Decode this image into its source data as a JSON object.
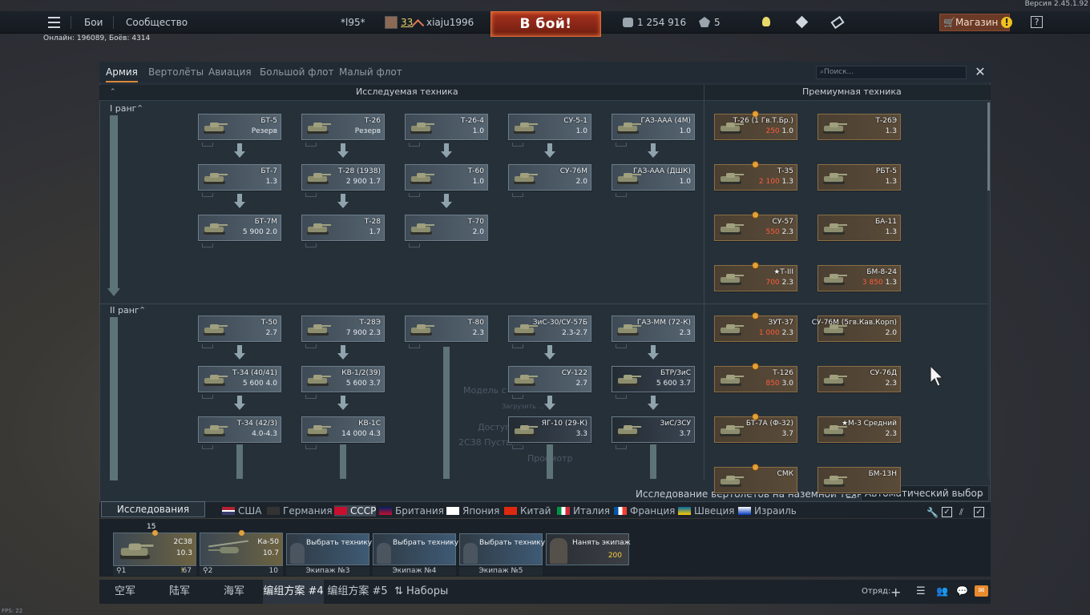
{
  "version": "Версия 2.45.1.92",
  "topbar": {
    "menu_icon": "hamburger-icon",
    "battles": "Бои",
    "community": "Сообщество",
    "squad_tag": "*l95*",
    "level": "33",
    "username": "xiaju1996",
    "battle_button": "В бой!",
    "silver": "1 254 916",
    "gold": "5",
    "shop": "Магазин",
    "shop_alert": "!",
    "help": "?"
  },
  "online": "Онлайн: 196089, Боёв: 4314",
  "tabs": [
    "Армия",
    "Вертолёты",
    "Авиация",
    "Большой флот",
    "Малый флот"
  ],
  "search_placeholder": "Поиск...",
  "headers": {
    "researchable": "Исследуемая техника",
    "premium": "Премиумная техника"
  },
  "ranks": [
    "I ранг",
    "II ранг"
  ],
  "research": [
    {
      "name": "БТ-5",
      "br": "Резерв"
    },
    {
      "name": "Т-26",
      "br": "Резерв"
    },
    {
      "name": "Т-26-4",
      "br": "1.0"
    },
    {
      "name": "СУ-5-1",
      "br": "1.0"
    },
    {
      "name": "ГАЗ-ААА (4М)",
      "br": "1.0"
    },
    {
      "name": "БТ-7",
      "br": "1.3"
    },
    {
      "name": "Т-28 (1938)",
      "cost": "2 900",
      "br": "1.7"
    },
    {
      "name": "Т-60",
      "br": "1.0"
    },
    {
      "name": "СУ-76М",
      "br": "2.0"
    },
    {
      "name": "ГАЗ-ААА (ДШК)",
      "br": "1.0"
    },
    {
      "name": "БТ-7М",
      "cost": "5 900",
      "br": "2.0"
    },
    {
      "name": "Т-28",
      "br": "1.7"
    },
    {
      "name": "Т-70",
      "br": "2.0"
    },
    {
      "name": "Т-50",
      "br": "2.7"
    },
    {
      "name": "Т-28Э",
      "cost": "7 900",
      "br": "2.3"
    },
    {
      "name": "Т-80",
      "br": "2.3"
    },
    {
      "name": "ЗиС-30/СУ-57Б",
      "br": "2.3-2.7"
    },
    {
      "name": "ГАЗ-ММ (72-К)",
      "br": "2.3"
    },
    {
      "name": "Т-34 (40/41)",
      "cost": "5 600",
      "br": "4.0"
    },
    {
      "name": "КВ-1/2(39)",
      "cost": "5 600",
      "br": "3.7"
    },
    {
      "name": "СУ-122",
      "br": "2.7"
    },
    {
      "name": "БТР/ЗиС",
      "cost": "5 600",
      "br": "3.7"
    },
    {
      "name": "Т-34 (42/3)",
      "br": "4.0-4.3"
    },
    {
      "name": "КВ-1С",
      "cost": "14 000",
      "br": "4.3"
    },
    {
      "name": "ЯГ-10 (29-К)",
      "br": "3.3"
    },
    {
      "name": "ЗиС/ЗСУ",
      "br": "3.7"
    }
  ],
  "premium": [
    {
      "name": "Т-26 (1 Гв.Т.Бр.)",
      "gold": "250",
      "br": "1.0"
    },
    {
      "name": "Т-26Э",
      "br": "1.3"
    },
    {
      "name": "Т-35",
      "gold": "2 100",
      "br": "1.3"
    },
    {
      "name": "РБТ-5",
      "br": "1.3"
    },
    {
      "name": "СУ-57",
      "gold": "550",
      "br": "2.3"
    },
    {
      "name": "БА-11",
      "br": "1.3"
    },
    {
      "name": "★Т-III",
      "gold": "700",
      "br": "2.3"
    },
    {
      "name": "БМ-8-24",
      "gold": "3 850",
      "br": "1.3"
    },
    {
      "name": "ЗУТ-37",
      "gold": "1 000",
      "br": "2.3"
    },
    {
      "name": "СУ-76М (5гв.Кав.Корп)",
      "br": "2.0"
    },
    {
      "name": "Т-126",
      "gold": "850",
      "br": "3.0"
    },
    {
      "name": "СУ-76Д",
      "br": "2.3"
    },
    {
      "name": "БТ-7А (Ф-32)",
      "br": "3.7"
    },
    {
      "name": "★М-3 Средний",
      "br": "2.3"
    },
    {
      "name": "СМК",
      "br": ""
    },
    {
      "name": "БМ-13Н",
      "br": ""
    }
  ],
  "heli_research": "Исследование вертолётов на наземной технике",
  "auto_select": "Автоматический выбор",
  "research_tab": "Исследования",
  "nations": [
    "США",
    "Германия",
    "СССР",
    "Британия",
    "Япония",
    "Китай",
    "Италия",
    "Франция",
    "Швеция",
    "Израиль"
  ],
  "crew": {
    "slot1": {
      "name": "2С38",
      "br": "10.3",
      "top": "15",
      "num": "1",
      "stat": "67"
    },
    "slot2": {
      "name": "Ка-50",
      "br": "10.7",
      "num": "2",
      "stat": "10"
    },
    "choose": "Выбрать технику",
    "hire": "Нанять экипаж",
    "hire_cost": "200",
    "labels": [
      "Экипаж №3",
      "Экипаж №4",
      "Экипаж №5"
    ]
  },
  "bottom_tabs": [
    "空军",
    "陆军",
    "海军",
    "编组方案 #4",
    "编组方案 #5",
    "Наборы"
  ],
  "squad": "Отряд:",
  "fps": "FPS: 22",
  "ghost": [
    "Модель с ...",
    "Загрузить ...",
    "Доступ...",
    "2С38 Пусты...",
    "Просмотр"
  ],
  "colors": {
    "accent": "#d9883a",
    "battle": "#a8321e",
    "gold": "#ff5b3a"
  }
}
